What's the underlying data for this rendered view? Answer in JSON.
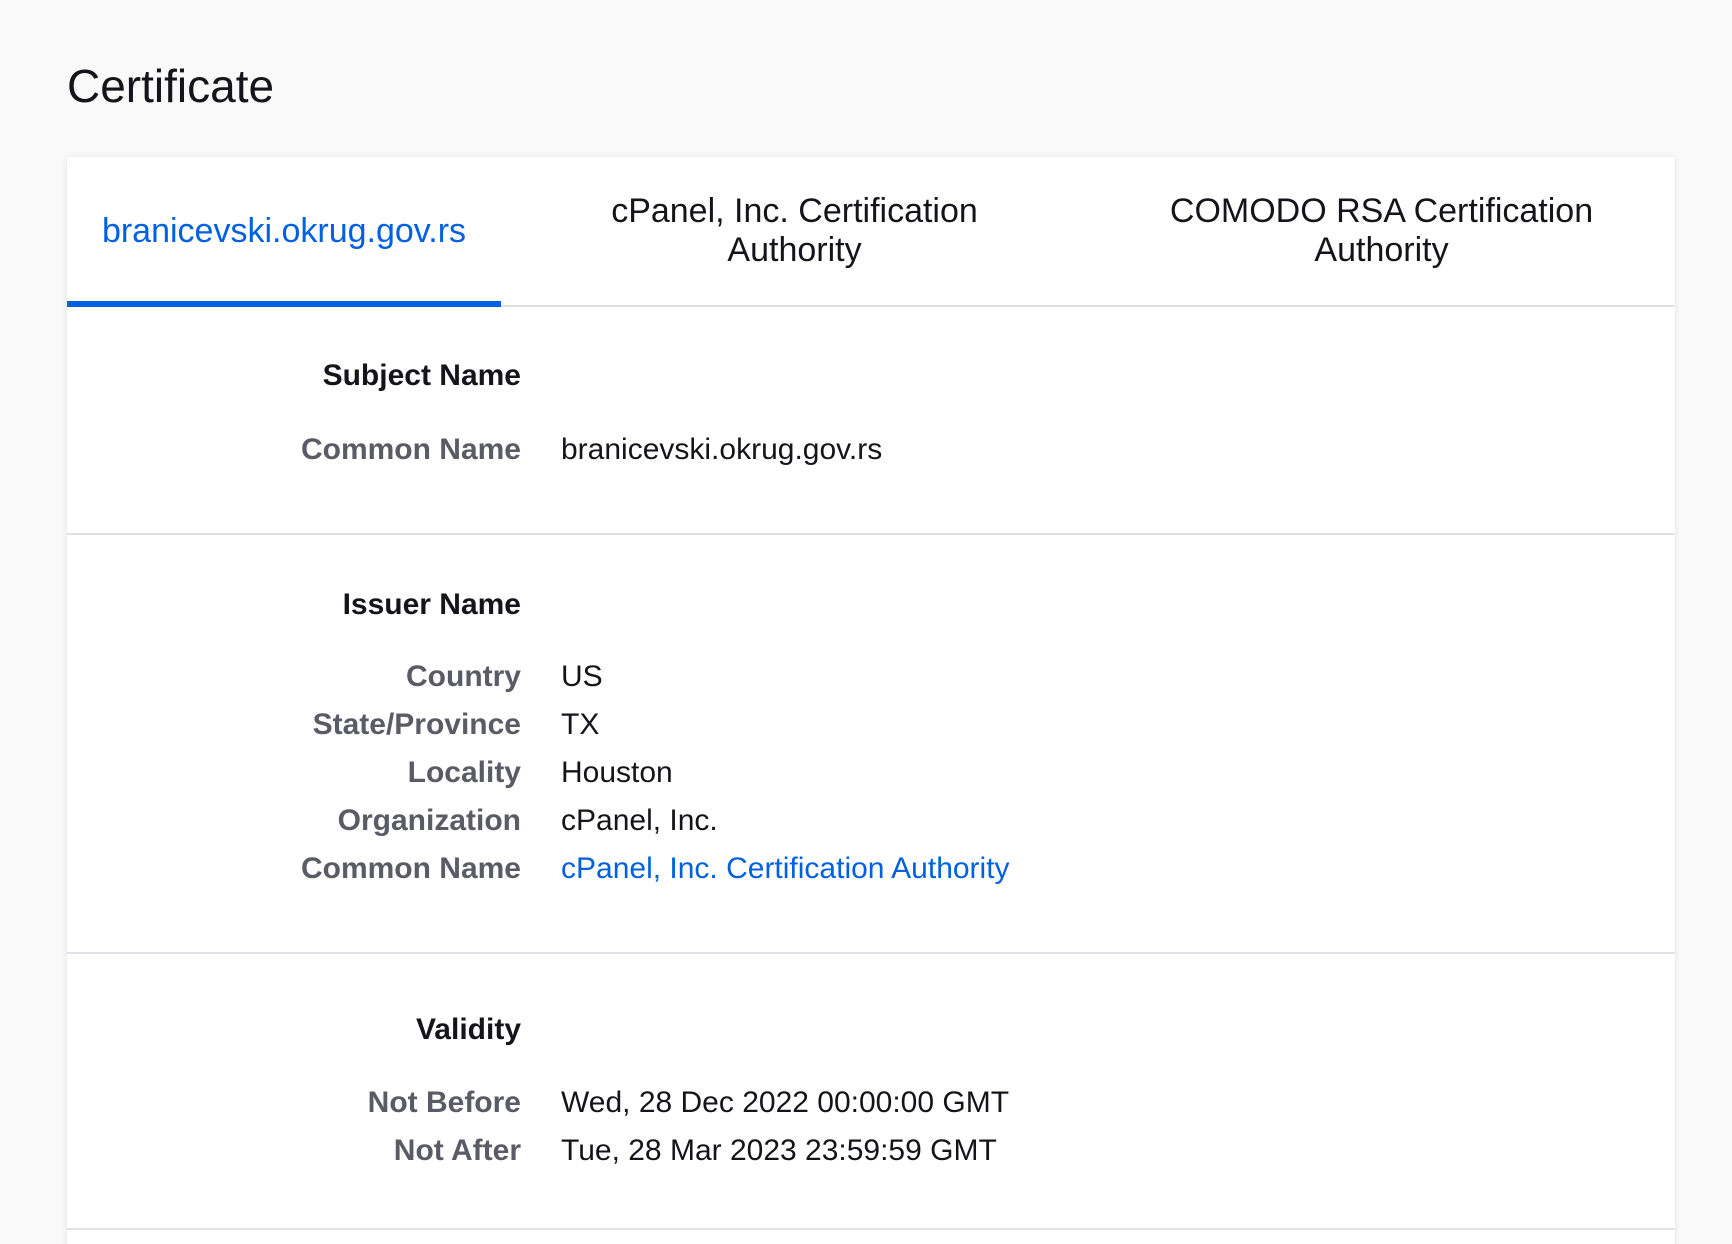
{
  "page_title": "Certificate",
  "tabs": [
    {
      "label": "branicevski.okrug.gov.rs",
      "active": true
    },
    {
      "label": "cPanel, Inc. Certification Authority",
      "active": false
    },
    {
      "label": "COMODO RSA Certification Authority",
      "active": false
    }
  ],
  "subject": {
    "title": "Subject Name",
    "common_name_label": "Common Name",
    "common_name_value": "branicevski.okrug.gov.rs"
  },
  "issuer": {
    "title": "Issuer Name",
    "country_label": "Country",
    "country_value": "US",
    "state_label": "State/Province",
    "state_value": "TX",
    "locality_label": "Locality",
    "locality_value": "Houston",
    "organization_label": "Organization",
    "organization_value": "cPanel, Inc.",
    "common_name_label": "Common Name",
    "common_name_value": "cPanel, Inc. Certification Authority"
  },
  "validity": {
    "title": "Validity",
    "not_before_label": "Not Before",
    "not_before_value": "Wed, 28 Dec 2022 00:00:00 GMT",
    "not_after_label": "Not After",
    "not_after_value": "Tue, 28 Mar 2023 23:59:59 GMT"
  },
  "colors": {
    "accent": "#0061e0",
    "label": "#5b5b66",
    "text": "#15141a",
    "divider": "#e0e0e6",
    "background": "#f9f9fa"
  }
}
